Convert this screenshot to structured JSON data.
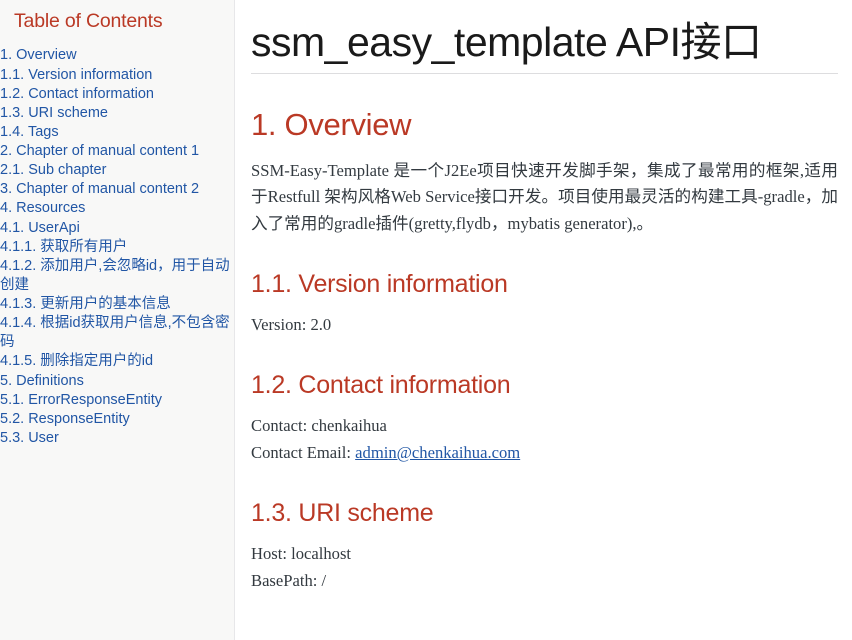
{
  "toc": {
    "title": "Table of Contents",
    "items": [
      {
        "level": 1,
        "label": "1. Overview"
      },
      {
        "level": 2,
        "label": "1.1. Version information"
      },
      {
        "level": 2,
        "label": "1.2. Contact information"
      },
      {
        "level": 2,
        "label": "1.3. URI scheme"
      },
      {
        "level": 2,
        "label": "1.4. Tags"
      },
      {
        "level": 1,
        "label": "2. Chapter of manual content 1"
      },
      {
        "level": 2,
        "label": "2.1. Sub chapter"
      },
      {
        "level": 1,
        "label": "3. Chapter of manual content 2"
      },
      {
        "level": 1,
        "label": "4. Resources"
      },
      {
        "level": 2,
        "label": "4.1. UserApi"
      },
      {
        "level": 3,
        "label": "4.1.1. 获取所有用户"
      },
      {
        "level": 3,
        "label": "4.1.2. 添加用户,会忽略id，用于自动创建"
      },
      {
        "level": 3,
        "label": "4.1.3. 更新用户的基本信息"
      },
      {
        "level": 3,
        "label": "4.1.4. 根据id获取用户信息,不包含密码"
      },
      {
        "level": 3,
        "label": "4.1.5. 删除指定用户的id"
      },
      {
        "level": 1,
        "label": "5. Definitions"
      },
      {
        "level": 2,
        "label": "5.1. ErrorResponseEntity"
      },
      {
        "level": 2,
        "label": "5.2. ResponseEntity"
      },
      {
        "level": 2,
        "label": "5.3. User"
      }
    ]
  },
  "document": {
    "title": "ssm_easy_template API接口",
    "sections": {
      "overview": {
        "heading": "1. Overview",
        "paragraph": "SSM-Easy-Template 是一个J2Ee项目快速开发脚手架，集成了最常用的框架,适用于Restfull 架构风格Web Service接口开发。项目使用最灵活的构建工具-gradle，加入了常用的gradle插件(gretty,flydb，mybatis generator),。"
      },
      "version": {
        "heading": "1.1. Version information",
        "version_line": "Version: 2.0"
      },
      "contact": {
        "heading": "1.2. Contact information",
        "contact_line": "Contact: chenkaihua",
        "email_label": "Contact Email: ",
        "email_value": "admin@chenkaihua.com"
      },
      "uri": {
        "heading": "1.3. URI scheme",
        "host_line": "Host: localhost",
        "basepath_line": "BasePath: /"
      }
    }
  },
  "colors": {
    "heading": "#ba3925",
    "link": "#2156a5",
    "body_text": "#333a40",
    "sidebar_bg": "#f8f8f7",
    "title": "#1a1a1a"
  }
}
